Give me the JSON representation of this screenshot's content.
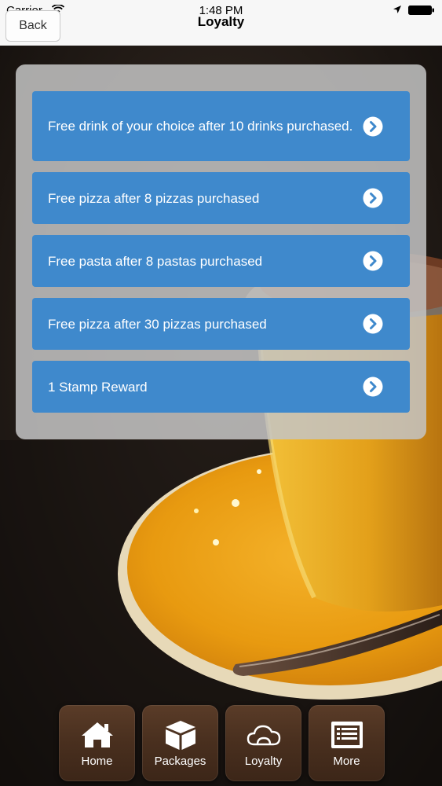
{
  "status_bar": {
    "carrier": "Carrier",
    "time": "1:48 PM"
  },
  "nav": {
    "title": "Loyalty",
    "back_label": "Back"
  },
  "rewards": [
    {
      "label": "Free drink of your choice after 10 drinks purchased."
    },
    {
      "label": "Free pizza after 8 pizzas purchased"
    },
    {
      "label": "Free pasta after 8 pastas purchased"
    },
    {
      "label": "Free pizza after 30 pizzas purchased"
    },
    {
      "label": "1 Stamp Reward"
    }
  ],
  "tabs": [
    {
      "label": "Home",
      "icon": "home-icon"
    },
    {
      "label": "Packages",
      "icon": "package-icon"
    },
    {
      "label": "Loyalty",
      "icon": "cloud-icon"
    },
    {
      "label": "More",
      "icon": "list-icon"
    }
  ],
  "colors": {
    "reward_row": "#3f89cc",
    "panel": "#c4c4c4",
    "tab_wood": "#4a301f"
  }
}
